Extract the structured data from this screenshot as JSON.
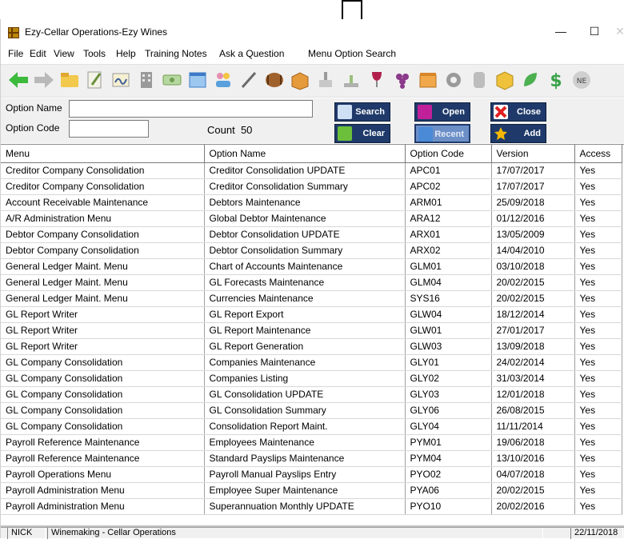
{
  "window": {
    "title": "Ezy-Cellar Operations-Ezy Wines"
  },
  "window_controls": {
    "minimize": "—",
    "maximize": "☐",
    "close": "✕"
  },
  "menubar": [
    "File",
    "Edit",
    "View",
    "Tools",
    "Help",
    "Training Notes",
    "Ask a Question",
    "Menu Option Search"
  ],
  "toolbar_icons": [
    "back-arrow-icon",
    "forward-arrow-icon",
    "folder-open-icon",
    "pen-notes-icon",
    "signature-icon",
    "building-icon",
    "money-icon",
    "window-icon",
    "users-icon",
    "pen-icon",
    "barrel-icon",
    "crate-icon",
    "bottle-press-icon",
    "scale-icon",
    "wine-glass-icon",
    "grapes-icon",
    "box-icon",
    "gear-icon",
    "tank-icon",
    "package-icon",
    "leaf-icon",
    "dollar-icon",
    "network-icon"
  ],
  "search": {
    "option_name_label": "Option Name",
    "option_name_value": "",
    "option_code_label": "Option Code",
    "option_code_value": "",
    "count_label": "Count",
    "count_value": "50",
    "buttons": {
      "search": "Search",
      "clear": "Clear",
      "open": "Open",
      "recent": "Recent",
      "close": "Close",
      "add": "Add"
    }
  },
  "table": {
    "columns": [
      "Menu",
      "Option Name",
      "Option Code",
      "Version",
      "Access"
    ],
    "rows": [
      [
        "Creditor Company Consolidation",
        "Creditor Consolidation UPDATE",
        "APC01",
        "17/07/2017",
        "Yes"
      ],
      [
        "Creditor Company Consolidation",
        "Creditor Consolidation Summary",
        "APC02",
        "17/07/2017",
        "Yes"
      ],
      [
        "Account Receivable Maintenance",
        "Debtors Maintenance",
        "ARM01",
        "25/09/2018",
        "Yes"
      ],
      [
        "A/R Administration Menu",
        "Global Debtor Maintenance",
        "ARA12",
        "01/12/2016",
        "Yes"
      ],
      [
        "Debtor Company Consolidation",
        "Debtor Consolidation UPDATE",
        "ARX01",
        "13/05/2009",
        "Yes"
      ],
      [
        "Debtor Company Consolidation",
        "Debtor Consolidation Summary",
        "ARX02",
        "14/04/2010",
        "Yes"
      ],
      [
        "General Ledger Maint. Menu",
        "Chart of Accounts Maintenance",
        "GLM01",
        "03/10/2018",
        "Yes"
      ],
      [
        "General Ledger Maint. Menu",
        "GL Forecasts Maintenance",
        "GLM04",
        "20/02/2015",
        "Yes"
      ],
      [
        "General Ledger Maint. Menu",
        "Currencies Maintenance",
        "SYS16",
        "20/02/2015",
        "Yes"
      ],
      [
        "GL Report Writer",
        "GL Report Export",
        "GLW04",
        "18/12/2014",
        "Yes"
      ],
      [
        "GL Report Writer",
        "GL Report Maintenance",
        "GLW01",
        "27/01/2017",
        "Yes"
      ],
      [
        "GL Report Writer",
        "GL Report Generation",
        "GLW03",
        "13/09/2018",
        "Yes"
      ],
      [
        "GL Company Consolidation",
        "Companies Maintenance",
        "GLY01",
        "24/02/2014",
        "Yes"
      ],
      [
        "GL Company Consolidation",
        "Companies Listing",
        "GLY02",
        "31/03/2014",
        "Yes"
      ],
      [
        "GL Company Consolidation",
        "GL Consolidation UPDATE",
        "GLY03",
        "12/01/2018",
        "Yes"
      ],
      [
        "GL Company Consolidation",
        "GL Consolidation Summary",
        "GLY06",
        "26/08/2015",
        "Yes"
      ],
      [
        "GL Company Consolidation",
        "Consolidation Report Maint.",
        "GLY04",
        "11/11/2014",
        "Yes"
      ],
      [
        "Payroll Reference Maintenance",
        "Employees Maintenance",
        "PYM01",
        "19/06/2018",
        "Yes"
      ],
      [
        "Payroll Reference Maintenance",
        "Standard Payslips Maintenance",
        "PYM04",
        "13/10/2016",
        "Yes"
      ],
      [
        "Payroll Operations Menu",
        "Payroll Manual Payslips Entry",
        "PYO02",
        "04/07/2018",
        "Yes"
      ],
      [
        "Payroll Administration Menu",
        "Employee Super Maintenance",
        "PYA06",
        "20/02/2015",
        "Yes"
      ],
      [
        "Payroll Administration Menu",
        "Superannuation Monthly UPDATE",
        "PYO10",
        "20/02/2016",
        "Yes"
      ]
    ]
  },
  "status": {
    "user": "NICK",
    "module": "Winemaking - Cellar Operations",
    "date": "22/11/2018"
  },
  "colors": {
    "button_bg": "#1f3a6a",
    "recent_bg": "#6d8fc7"
  }
}
